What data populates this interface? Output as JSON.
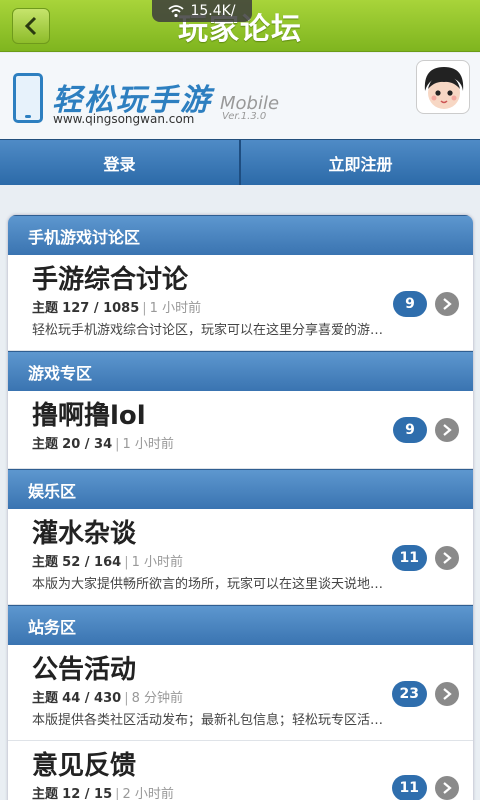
{
  "header": {
    "title": "玩家论坛",
    "status_speed": "15.4K/"
  },
  "logo": {
    "name_cn": "轻松玩手游",
    "url": "www.qingsongwan.com",
    "mobile": "Mobile",
    "version": "Ver.1.3.0"
  },
  "auth": {
    "login": "登录",
    "register": "立即注册"
  },
  "categories": [
    {
      "title": "手机游戏讨论区"
    },
    {
      "title": "游戏专区"
    },
    {
      "title": "娱乐区"
    },
    {
      "title": "站务区"
    }
  ],
  "boards": [
    {
      "name": "手游综合讨论",
      "threads": "127 / 1085",
      "time": "1 小时前",
      "desc": "轻松玩手机游戏综合讨论区，玩家可以在这里分享喜爱的游…",
      "badge": "9"
    },
    {
      "name": "撸啊撸lol",
      "threads": "20 / 34",
      "time": "1 小时前",
      "desc": "",
      "badge": "9"
    },
    {
      "name": "灌水杂谈",
      "threads": "52 / 164",
      "time": "1 小时前",
      "desc": "本版为大家提供畅所欲言的场所，玩家可以在这里谈天说地…",
      "badge": "11"
    },
    {
      "name": "公告活动",
      "threads": "44 / 430",
      "time": "8 分钟前",
      "desc": "本版提供各类社区活动发布；最新礼包信息；轻松玩专区活…",
      "badge": "23"
    },
    {
      "name": "意见反馈",
      "threads": "12 / 15",
      "time": "2 小时前",
      "desc": "",
      "badge": "11"
    }
  ],
  "labels": {
    "topic_prefix": "主题"
  }
}
